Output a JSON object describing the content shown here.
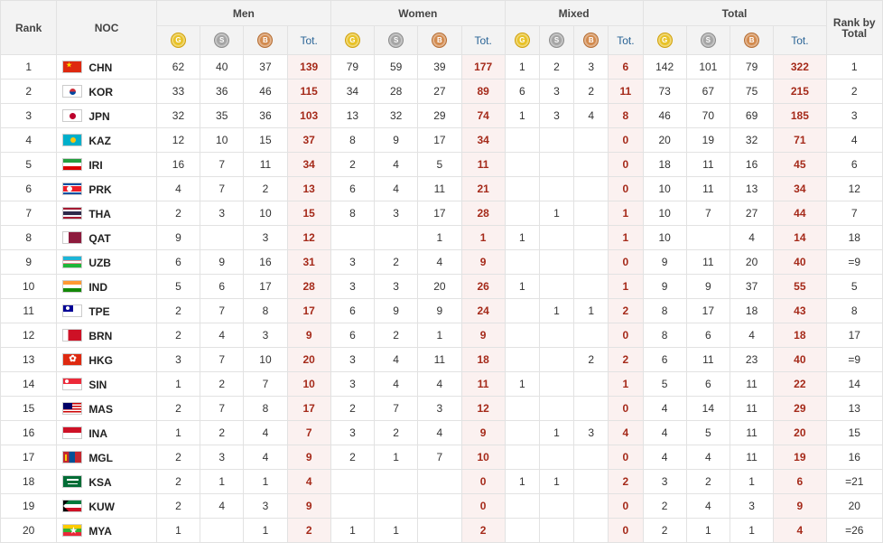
{
  "headers": {
    "rank": "Rank",
    "noc": "NOC",
    "groups": [
      "Men",
      "Women",
      "Mixed",
      "Total"
    ],
    "gold_icon": "G",
    "silver_icon": "S",
    "bronze_icon": "B",
    "tot": "Tot.",
    "rank_by_total": "Rank by Total"
  },
  "colors": {
    "gold": "#e8c228",
    "silver": "#a5a5a5",
    "bronze": "#d38b4f",
    "total_text": "#a52a1a",
    "total_bg": "#fbf1f0"
  },
  "rows": [
    {
      "rank": "1",
      "code": "CHN",
      "flag": "china-flag",
      "men": [
        "62",
        "40",
        "37",
        "139"
      ],
      "women": [
        "79",
        "59",
        "39",
        "177"
      ],
      "mixed": [
        "1",
        "2",
        "3",
        "6"
      ],
      "total": [
        "142",
        "101",
        "79",
        "322"
      ],
      "rbt": "1"
    },
    {
      "rank": "2",
      "code": "KOR",
      "flag": "korea-flag",
      "men": [
        "33",
        "36",
        "46",
        "115"
      ],
      "women": [
        "34",
        "28",
        "27",
        "89"
      ],
      "mixed": [
        "6",
        "3",
        "2",
        "11"
      ],
      "total": [
        "73",
        "67",
        "75",
        "215"
      ],
      "rbt": "2"
    },
    {
      "rank": "3",
      "code": "JPN",
      "flag": "japan-flag",
      "men": [
        "32",
        "35",
        "36",
        "103"
      ],
      "women": [
        "13",
        "32",
        "29",
        "74"
      ],
      "mixed": [
        "1",
        "3",
        "4",
        "8"
      ],
      "total": [
        "46",
        "70",
        "69",
        "185"
      ],
      "rbt": "3"
    },
    {
      "rank": "4",
      "code": "KAZ",
      "flag": "kazakhstan-flag",
      "men": [
        "12",
        "10",
        "15",
        "37"
      ],
      "women": [
        "8",
        "9",
        "17",
        "34"
      ],
      "mixed": [
        "",
        "",
        "",
        "0"
      ],
      "total": [
        "20",
        "19",
        "32",
        "71"
      ],
      "rbt": "4"
    },
    {
      "rank": "5",
      "code": "IRI",
      "flag": "iran-flag",
      "men": [
        "16",
        "7",
        "11",
        "34"
      ],
      "women": [
        "2",
        "4",
        "5",
        "11"
      ],
      "mixed": [
        "",
        "",
        "",
        "0"
      ],
      "total": [
        "18",
        "11",
        "16",
        "45"
      ],
      "rbt": "6"
    },
    {
      "rank": "6",
      "code": "PRK",
      "flag": "north-korea-flag",
      "men": [
        "4",
        "7",
        "2",
        "13"
      ],
      "women": [
        "6",
        "4",
        "11",
        "21"
      ],
      "mixed": [
        "",
        "",
        "",
        "0"
      ],
      "total": [
        "10",
        "11",
        "13",
        "34"
      ],
      "rbt": "12"
    },
    {
      "rank": "7",
      "code": "THA",
      "flag": "thailand-flag",
      "men": [
        "2",
        "3",
        "10",
        "15"
      ],
      "women": [
        "8",
        "3",
        "17",
        "28"
      ],
      "mixed": [
        "",
        "1",
        "",
        "1"
      ],
      "total": [
        "10",
        "7",
        "27",
        "44"
      ],
      "rbt": "7"
    },
    {
      "rank": "8",
      "code": "QAT",
      "flag": "qatar-flag",
      "men": [
        "9",
        "",
        "3",
        "12"
      ],
      "women": [
        "",
        "",
        "1",
        "1"
      ],
      "mixed": [
        "1",
        "",
        "",
        "1"
      ],
      "total": [
        "10",
        "",
        "4",
        "14"
      ],
      "rbt": "18"
    },
    {
      "rank": "9",
      "code": "UZB",
      "flag": "uzbekistan-flag",
      "men": [
        "6",
        "9",
        "16",
        "31"
      ],
      "women": [
        "3",
        "2",
        "4",
        "9"
      ],
      "mixed": [
        "",
        "",
        "",
        "0"
      ],
      "total": [
        "9",
        "11",
        "20",
        "40"
      ],
      "rbt": "=9"
    },
    {
      "rank": "10",
      "code": "IND",
      "flag": "india-flag",
      "men": [
        "5",
        "6",
        "17",
        "28"
      ],
      "women": [
        "3",
        "3",
        "20",
        "26"
      ],
      "mixed": [
        "1",
        "",
        "",
        "1"
      ],
      "total": [
        "9",
        "9",
        "37",
        "55"
      ],
      "rbt": "5"
    },
    {
      "rank": "11",
      "code": "TPE",
      "flag": "chinese-taipei-flag",
      "men": [
        "2",
        "7",
        "8",
        "17"
      ],
      "women": [
        "6",
        "9",
        "9",
        "24"
      ],
      "mixed": [
        "",
        "1",
        "1",
        "2"
      ],
      "total": [
        "8",
        "17",
        "18",
        "43"
      ],
      "rbt": "8"
    },
    {
      "rank": "12",
      "code": "BRN",
      "flag": "bahrain-flag",
      "men": [
        "2",
        "4",
        "3",
        "9"
      ],
      "women": [
        "6",
        "2",
        "1",
        "9"
      ],
      "mixed": [
        "",
        "",
        "",
        "0"
      ],
      "total": [
        "8",
        "6",
        "4",
        "18"
      ],
      "rbt": "17"
    },
    {
      "rank": "13",
      "code": "HKG",
      "flag": "hong-kong-flag",
      "men": [
        "3",
        "7",
        "10",
        "20"
      ],
      "women": [
        "3",
        "4",
        "11",
        "18"
      ],
      "mixed": [
        "",
        "",
        "2",
        "2"
      ],
      "total": [
        "6",
        "11",
        "23",
        "40"
      ],
      "rbt": "=9"
    },
    {
      "rank": "14",
      "code": "SIN",
      "flag": "singapore-flag",
      "men": [
        "1",
        "2",
        "7",
        "10"
      ],
      "women": [
        "3",
        "4",
        "4",
        "11"
      ],
      "mixed": [
        "1",
        "",
        "",
        "1"
      ],
      "total": [
        "5",
        "6",
        "11",
        "22"
      ],
      "rbt": "14"
    },
    {
      "rank": "15",
      "code": "MAS",
      "flag": "malaysia-flag",
      "men": [
        "2",
        "7",
        "8",
        "17"
      ],
      "women": [
        "2",
        "7",
        "3",
        "12"
      ],
      "mixed": [
        "",
        "",
        "",
        "0"
      ],
      "total": [
        "4",
        "14",
        "11",
        "29"
      ],
      "rbt": "13"
    },
    {
      "rank": "16",
      "code": "INA",
      "flag": "indonesia-flag",
      "men": [
        "1",
        "2",
        "4",
        "7"
      ],
      "women": [
        "3",
        "2",
        "4",
        "9"
      ],
      "mixed": [
        "",
        "1",
        "3",
        "4"
      ],
      "total": [
        "4",
        "5",
        "11",
        "20"
      ],
      "rbt": "15"
    },
    {
      "rank": "17",
      "code": "MGL",
      "flag": "mongolia-flag",
      "men": [
        "2",
        "3",
        "4",
        "9"
      ],
      "women": [
        "2",
        "1",
        "7",
        "10"
      ],
      "mixed": [
        "",
        "",
        "",
        "0"
      ],
      "total": [
        "4",
        "4",
        "11",
        "19"
      ],
      "rbt": "16"
    },
    {
      "rank": "18",
      "code": "KSA",
      "flag": "saudi-arabia-flag",
      "men": [
        "2",
        "1",
        "1",
        "4"
      ],
      "women": [
        "",
        "",
        "",
        "0"
      ],
      "mixed": [
        "1",
        "1",
        "",
        "2"
      ],
      "total": [
        "3",
        "2",
        "1",
        "6"
      ],
      "rbt": "=21"
    },
    {
      "rank": "19",
      "code": "KUW",
      "flag": "kuwait-flag",
      "men": [
        "2",
        "4",
        "3",
        "9"
      ],
      "women": [
        "",
        "",
        "",
        "0"
      ],
      "mixed": [
        "",
        "",
        "",
        "0"
      ],
      "total": [
        "2",
        "4",
        "3",
        "9"
      ],
      "rbt": "20"
    },
    {
      "rank": "20",
      "code": "MYA",
      "flag": "myanmar-flag",
      "men": [
        "1",
        "",
        "1",
        "2"
      ],
      "women": [
        "1",
        "1",
        "",
        "2"
      ],
      "mixed": [
        "",
        "",
        "",
        "0"
      ],
      "total": [
        "2",
        "1",
        "1",
        "4"
      ],
      "rbt": "=26"
    }
  ]
}
